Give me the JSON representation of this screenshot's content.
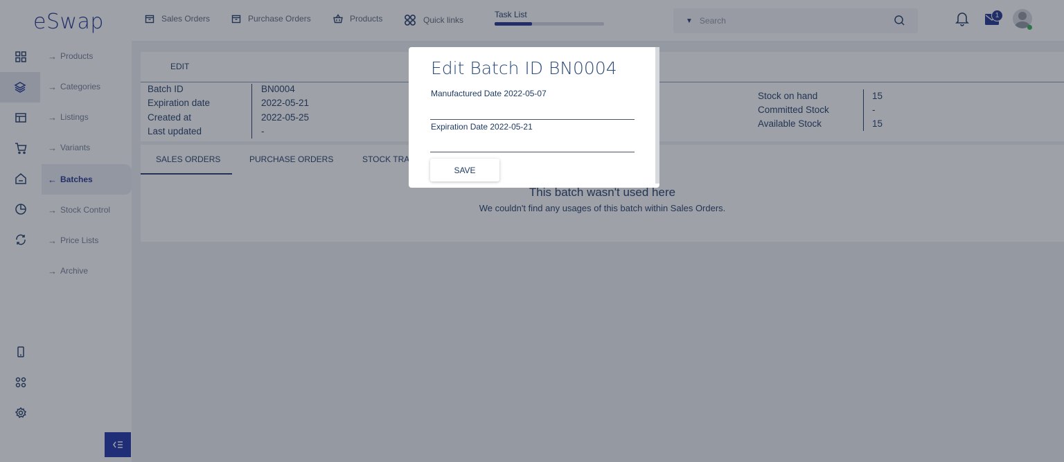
{
  "app": {
    "logo": "eSwap"
  },
  "topbar": {
    "links": [
      {
        "label": "Sales Orders",
        "icon": "box-icon"
      },
      {
        "label": "Purchase Orders",
        "icon": "box-icon"
      },
      {
        "label": "Products",
        "icon": "basket-icon"
      },
      {
        "label": "Quick links",
        "icon": "grid-icon"
      }
    ],
    "task_list": {
      "label": "Task List",
      "progress": 0.34
    },
    "search": {
      "placeholder": "Search"
    },
    "notifications": {
      "mail_badge": "1"
    }
  },
  "sidebar": {
    "items": [
      {
        "label": "Products",
        "active": false
      },
      {
        "label": "Categories",
        "active": false
      },
      {
        "label": "Listings",
        "active": false
      },
      {
        "label": "Variants",
        "active": false
      },
      {
        "label": "Batches",
        "active": true
      },
      {
        "label": "Stock Control",
        "active": false
      },
      {
        "label": "Price Lists",
        "active": false
      },
      {
        "label": "Archive",
        "active": false
      }
    ]
  },
  "main": {
    "edit_label": "EDIT",
    "details_left": [
      {
        "label": "Batch ID",
        "value": "BN0004"
      },
      {
        "label": "Expiration date",
        "value": "2022-05-21"
      },
      {
        "label": "Created at",
        "value": "2022-05-25"
      },
      {
        "label": "Last updated",
        "value": "-"
      }
    ],
    "details_right": [
      {
        "label": "Stock on hand",
        "value": "15"
      },
      {
        "label": "Committed Stock",
        "value": "-"
      },
      {
        "label": "Available Stock",
        "value": "15"
      }
    ],
    "tabs": [
      "SALES ORDERS",
      "PURCHASE ORDERS",
      "STOCK TRA"
    ],
    "empty_state": {
      "title": "This batch wasn't used here",
      "subtitle": "We couldn't find any usages of this batch within Sales Orders."
    }
  },
  "modal": {
    "title": "Edit Batch ID BN0004",
    "manufactured_label": "Manufactured Date 2022-05-07",
    "manufactured_value": "",
    "expiration_label": "Expiration Date 2022-05-21",
    "expiration_value": "",
    "save_label": "SAVE"
  },
  "colors": {
    "brand": "#1c2f8a",
    "text": "#1e3a63",
    "online": "#2fb050"
  }
}
